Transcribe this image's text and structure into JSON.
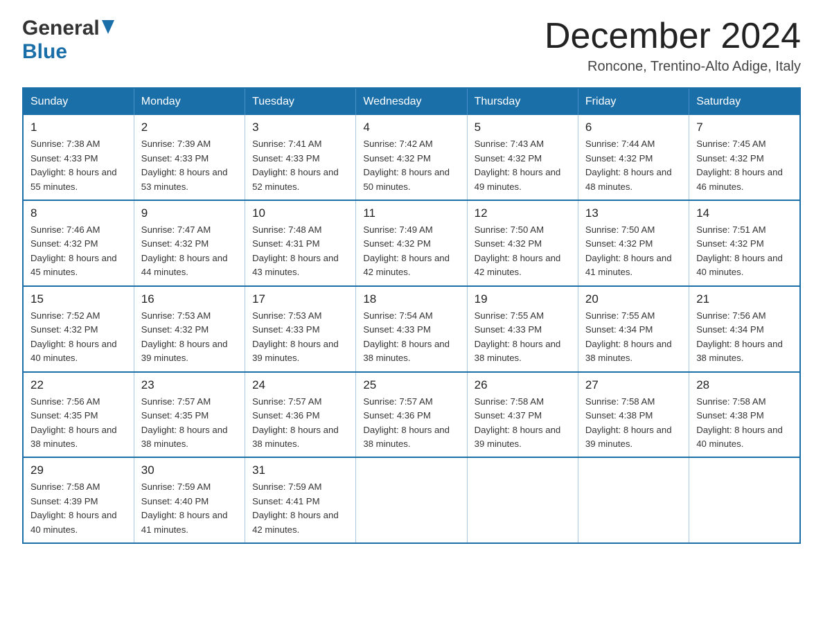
{
  "header": {
    "logo_general": "General",
    "logo_blue": "Blue",
    "title": "December 2024",
    "location": "Roncone, Trentino-Alto Adige, Italy"
  },
  "calendar": {
    "days_of_week": [
      "Sunday",
      "Monday",
      "Tuesday",
      "Wednesday",
      "Thursday",
      "Friday",
      "Saturday"
    ],
    "weeks": [
      [
        {
          "day": "1",
          "sunrise": "7:38 AM",
          "sunset": "4:33 PM",
          "daylight": "8 hours and 55 minutes."
        },
        {
          "day": "2",
          "sunrise": "7:39 AM",
          "sunset": "4:33 PM",
          "daylight": "8 hours and 53 minutes."
        },
        {
          "day": "3",
          "sunrise": "7:41 AM",
          "sunset": "4:33 PM",
          "daylight": "8 hours and 52 minutes."
        },
        {
          "day": "4",
          "sunrise": "7:42 AM",
          "sunset": "4:32 PM",
          "daylight": "8 hours and 50 minutes."
        },
        {
          "day": "5",
          "sunrise": "7:43 AM",
          "sunset": "4:32 PM",
          "daylight": "8 hours and 49 minutes."
        },
        {
          "day": "6",
          "sunrise": "7:44 AM",
          "sunset": "4:32 PM",
          "daylight": "8 hours and 48 minutes."
        },
        {
          "day": "7",
          "sunrise": "7:45 AM",
          "sunset": "4:32 PM",
          "daylight": "8 hours and 46 minutes."
        }
      ],
      [
        {
          "day": "8",
          "sunrise": "7:46 AM",
          "sunset": "4:32 PM",
          "daylight": "8 hours and 45 minutes."
        },
        {
          "day": "9",
          "sunrise": "7:47 AM",
          "sunset": "4:32 PM",
          "daylight": "8 hours and 44 minutes."
        },
        {
          "day": "10",
          "sunrise": "7:48 AM",
          "sunset": "4:31 PM",
          "daylight": "8 hours and 43 minutes."
        },
        {
          "day": "11",
          "sunrise": "7:49 AM",
          "sunset": "4:32 PM",
          "daylight": "8 hours and 42 minutes."
        },
        {
          "day": "12",
          "sunrise": "7:50 AM",
          "sunset": "4:32 PM",
          "daylight": "8 hours and 42 minutes."
        },
        {
          "day": "13",
          "sunrise": "7:50 AM",
          "sunset": "4:32 PM",
          "daylight": "8 hours and 41 minutes."
        },
        {
          "day": "14",
          "sunrise": "7:51 AM",
          "sunset": "4:32 PM",
          "daylight": "8 hours and 40 minutes."
        }
      ],
      [
        {
          "day": "15",
          "sunrise": "7:52 AM",
          "sunset": "4:32 PM",
          "daylight": "8 hours and 40 minutes."
        },
        {
          "day": "16",
          "sunrise": "7:53 AM",
          "sunset": "4:32 PM",
          "daylight": "8 hours and 39 minutes."
        },
        {
          "day": "17",
          "sunrise": "7:53 AM",
          "sunset": "4:33 PM",
          "daylight": "8 hours and 39 minutes."
        },
        {
          "day": "18",
          "sunrise": "7:54 AM",
          "sunset": "4:33 PM",
          "daylight": "8 hours and 38 minutes."
        },
        {
          "day": "19",
          "sunrise": "7:55 AM",
          "sunset": "4:33 PM",
          "daylight": "8 hours and 38 minutes."
        },
        {
          "day": "20",
          "sunrise": "7:55 AM",
          "sunset": "4:34 PM",
          "daylight": "8 hours and 38 minutes."
        },
        {
          "day": "21",
          "sunrise": "7:56 AM",
          "sunset": "4:34 PM",
          "daylight": "8 hours and 38 minutes."
        }
      ],
      [
        {
          "day": "22",
          "sunrise": "7:56 AM",
          "sunset": "4:35 PM",
          "daylight": "8 hours and 38 minutes."
        },
        {
          "day": "23",
          "sunrise": "7:57 AM",
          "sunset": "4:35 PM",
          "daylight": "8 hours and 38 minutes."
        },
        {
          "day": "24",
          "sunrise": "7:57 AM",
          "sunset": "4:36 PM",
          "daylight": "8 hours and 38 minutes."
        },
        {
          "day": "25",
          "sunrise": "7:57 AM",
          "sunset": "4:36 PM",
          "daylight": "8 hours and 38 minutes."
        },
        {
          "day": "26",
          "sunrise": "7:58 AM",
          "sunset": "4:37 PM",
          "daylight": "8 hours and 39 minutes."
        },
        {
          "day": "27",
          "sunrise": "7:58 AM",
          "sunset": "4:38 PM",
          "daylight": "8 hours and 39 minutes."
        },
        {
          "day": "28",
          "sunrise": "7:58 AM",
          "sunset": "4:38 PM",
          "daylight": "8 hours and 40 minutes."
        }
      ],
      [
        {
          "day": "29",
          "sunrise": "7:58 AM",
          "sunset": "4:39 PM",
          "daylight": "8 hours and 40 minutes."
        },
        {
          "day": "30",
          "sunrise": "7:59 AM",
          "sunset": "4:40 PM",
          "daylight": "8 hours and 41 minutes."
        },
        {
          "day": "31",
          "sunrise": "7:59 AM",
          "sunset": "4:41 PM",
          "daylight": "8 hours and 42 minutes."
        },
        null,
        null,
        null,
        null
      ]
    ]
  }
}
